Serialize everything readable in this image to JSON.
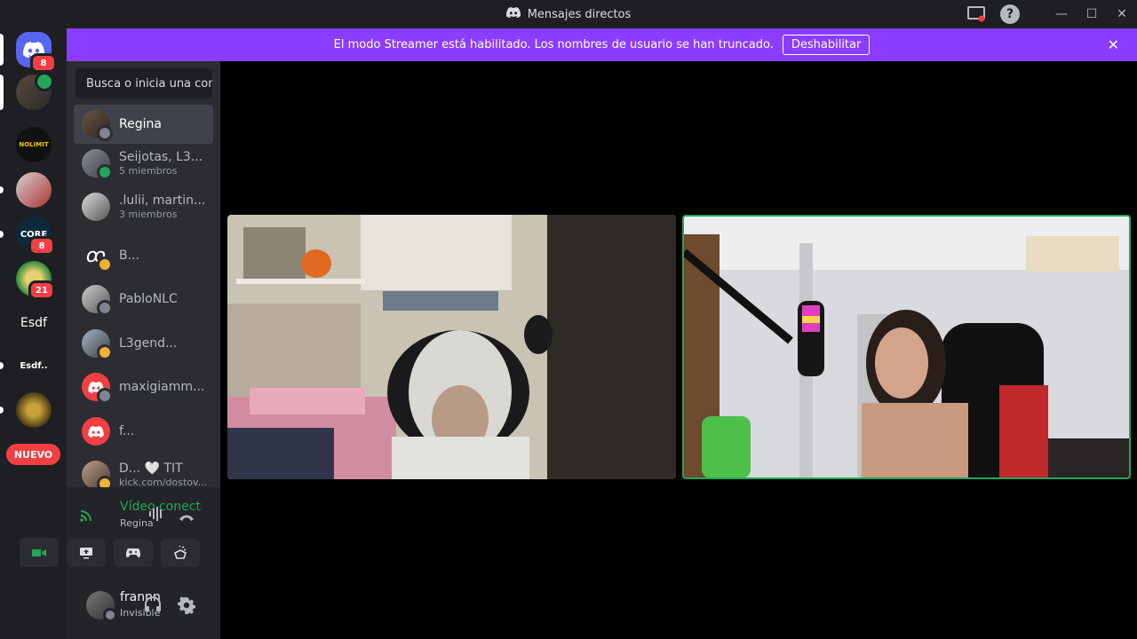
{
  "titlebar": {
    "title": "Mensajes directos"
  },
  "banner": {
    "message": "El modo Streamer está habilitado. Los nombres de usuario se han truncado.",
    "button": "Deshabilitar"
  },
  "guilds": {
    "home_badge": "8",
    "items": [
      {
        "label": "NOLIMIT",
        "badge": ""
      },
      {
        "label": "",
        "badge": ""
      },
      {
        "label": "CORE",
        "badge": "8"
      },
      {
        "label": "",
        "badge": "21"
      },
      {
        "label": "Esdf",
        "badge": ""
      },
      {
        "label": "Esdf..",
        "badge": ""
      },
      {
        "label": "",
        "badge": ""
      }
    ],
    "nuevo": "NUEVO"
  },
  "search": {
    "placeholder": "Busca o inicia una con..."
  },
  "dms": [
    {
      "name": "Regina",
      "sub": ""
    },
    {
      "name": "Seijotas, L3...",
      "sub": "5 miembros"
    },
    {
      "name": ".lulii, martin...",
      "sub": "3 miembros"
    },
    {
      "name": "B...",
      "sub": ""
    },
    {
      "name": "PabloNLC",
      "sub": ""
    },
    {
      "name": "L3gend...",
      "sub": ""
    },
    {
      "name": "maxigiamm...",
      "sub": ""
    },
    {
      "name": "f...",
      "sub": ""
    },
    {
      "name": "D... 🤍 TIT",
      "sub": "kick.com/dostov..."
    }
  ],
  "voice": {
    "status": "Vídeo conectado",
    "channel": "Regina"
  },
  "user": {
    "name": "frannn",
    "status": "Invisible"
  },
  "colors": {
    "accent": "#8b3dff",
    "online": "#23a55a",
    "danger": "#f23f43",
    "blurple": "#5865f2"
  }
}
